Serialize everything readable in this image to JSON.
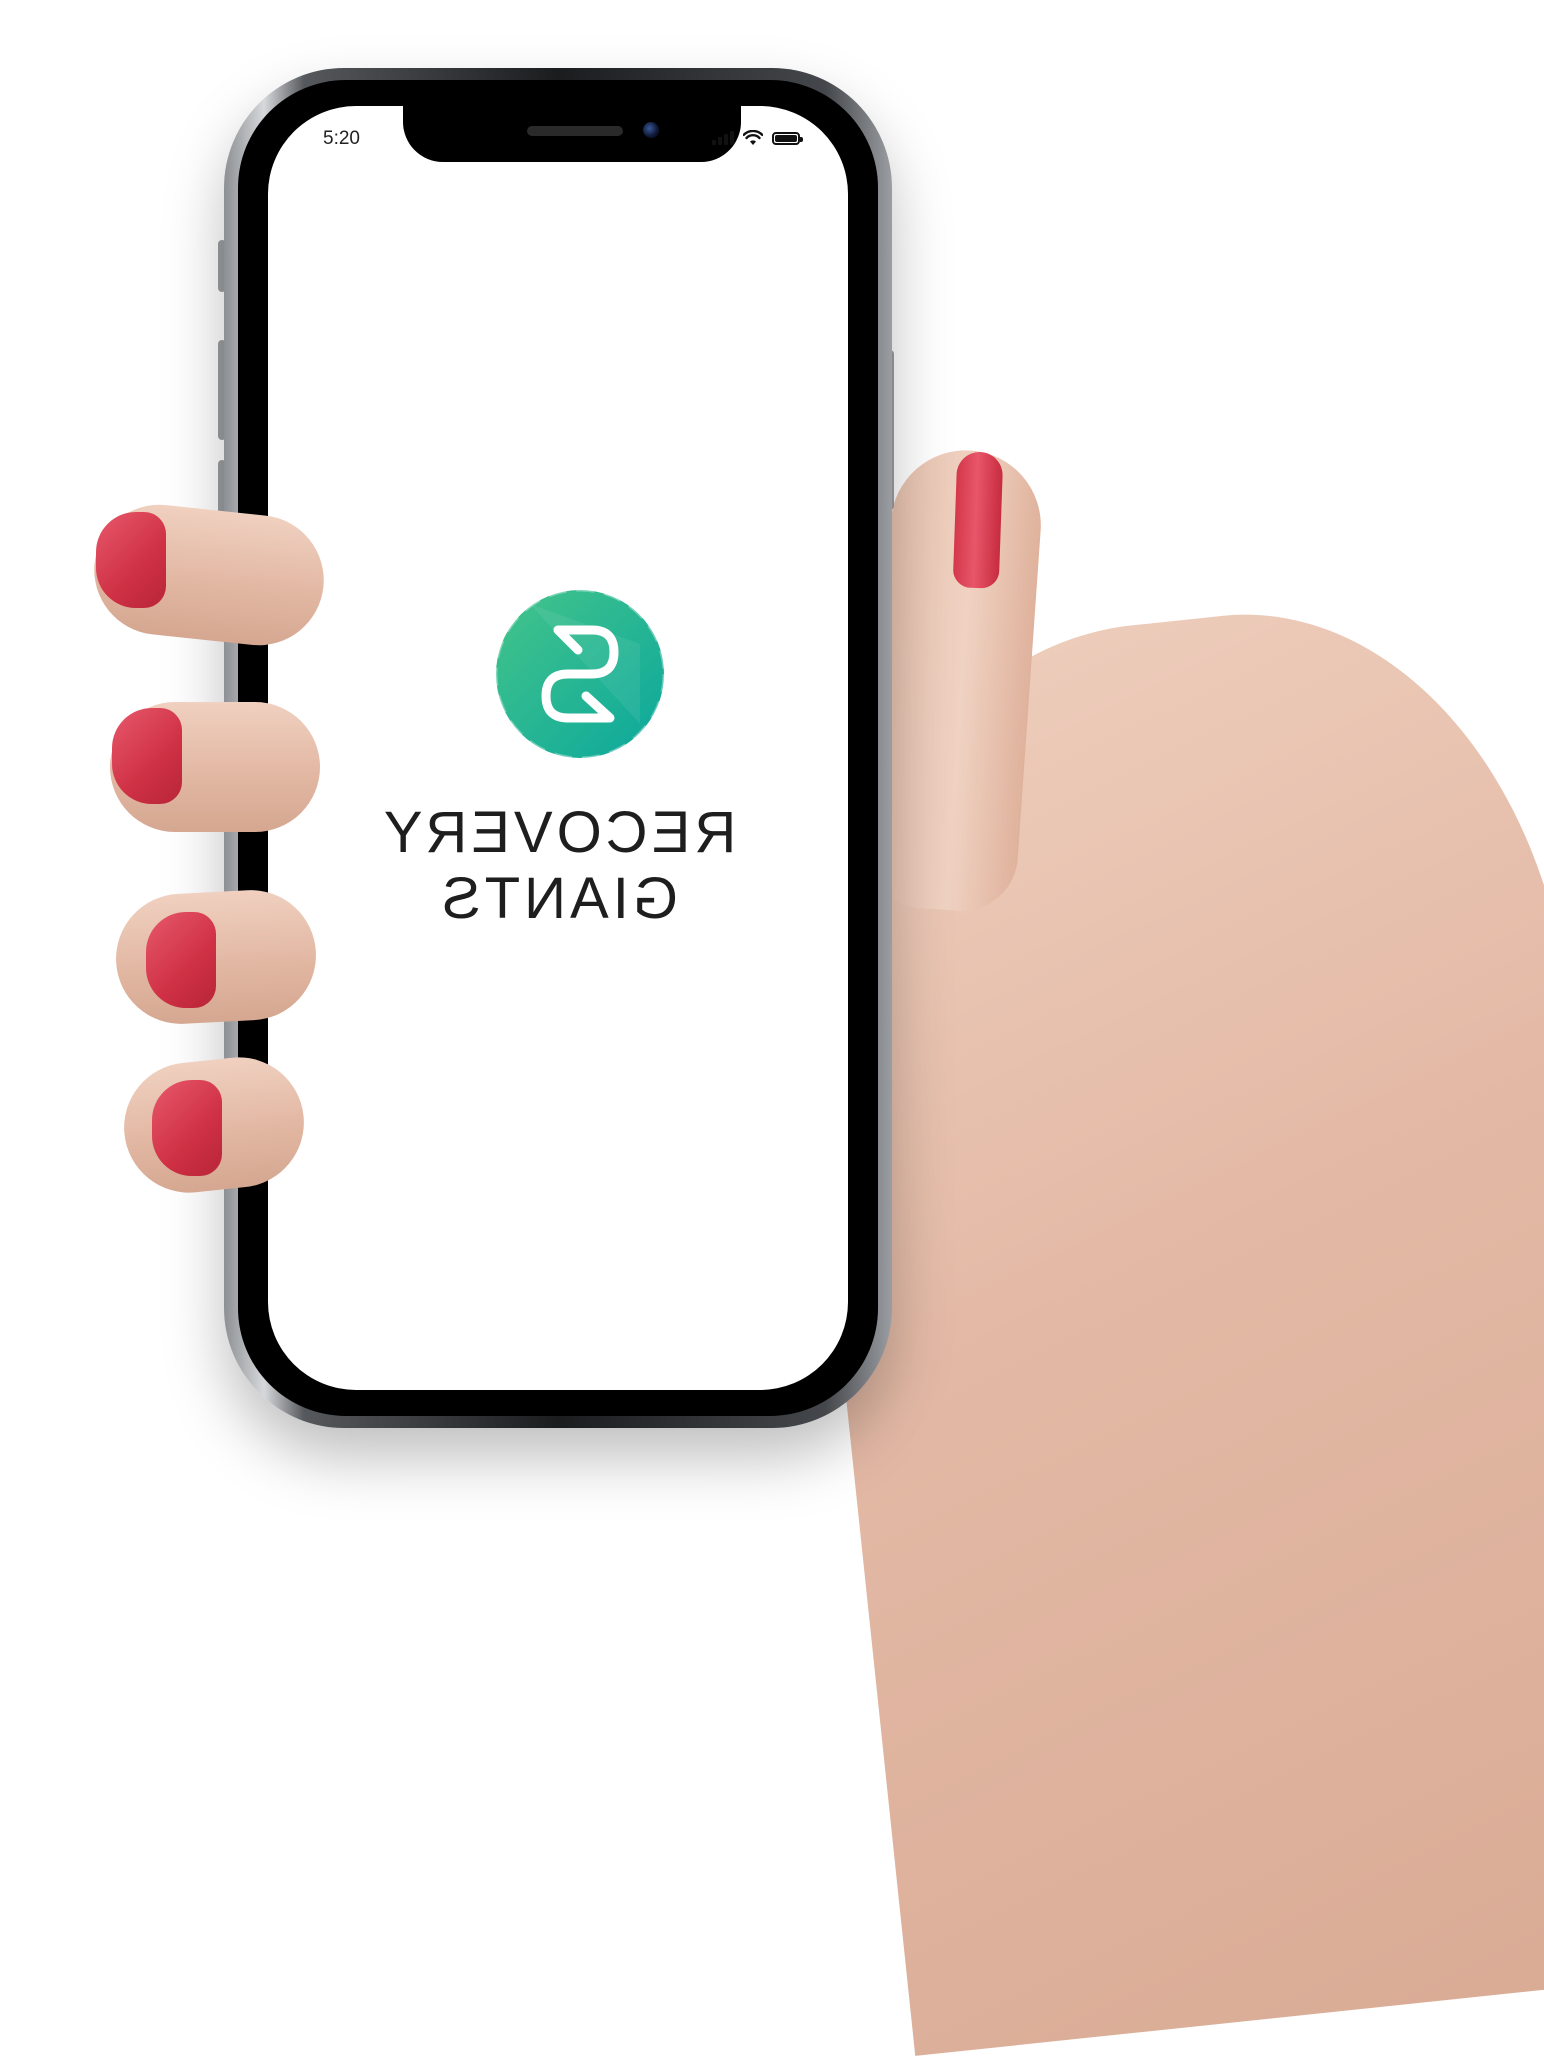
{
  "status_bar": {
    "time": "5:20"
  },
  "splash": {
    "logo_icon": "recovery-giants-s-logo",
    "brand_line1": "RECOVERY",
    "brand_line2": "GIANTS",
    "mirrored": true
  },
  "colors": {
    "logo_start": "#3cc08a",
    "logo_end": "#0aa99a",
    "text": "#1e1e1e",
    "nail": "#d6364a"
  }
}
